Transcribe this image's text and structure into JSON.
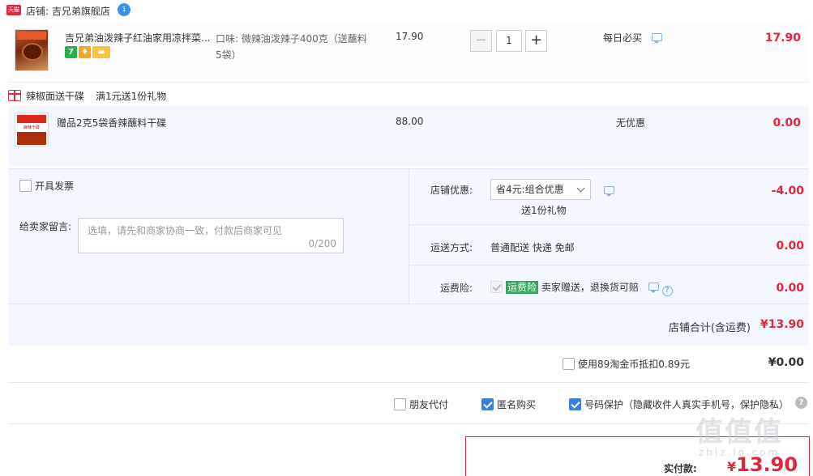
{
  "shop": {
    "badge": "天猫",
    "name": "店铺: 吉兄弟旗舰店",
    "ww_badge": "1"
  },
  "item1": {
    "title": "吉兄弟油泼辣子红油家用凉拌菜...",
    "tag_seven": "7",
    "spec": "口味: 微辣油泼辣子400克（送蘸料5袋）",
    "unit_price": "17.90",
    "quantity": "1",
    "minus": "−",
    "plus": "+",
    "promo": "每日必买",
    "total": "17.90"
  },
  "gift": {
    "header_a": "辣椒面送干碟",
    "header_b": "满1元送1份礼物",
    "thumb_text": "麻辣干碟",
    "title": "赠品2克5袋香辣蘸料干碟",
    "unit_price": "88.00",
    "promo": "无优惠",
    "total": "0.00"
  },
  "options": {
    "invoice_label": "开具发票",
    "message_label": "给卖家留言:",
    "message_placeholder": "选填，请先和商家协商一致，付款后商家可见",
    "message_count": "0/200",
    "shop_discount_label": "店铺优惠:",
    "shop_discount_selected": "省4元:组合优惠",
    "shop_discount_note": "送1份礼物",
    "shop_discount_value": "-4.00",
    "shipping_label": "运送方式:",
    "shipping_value": "普通配送 快递 免邮",
    "shipping_cost": "0.00",
    "insurance_label": "运费险:",
    "insurance_tag": "运费险",
    "insurance_text": "卖家赠送，退换货可赔",
    "insurance_cost": "0.00",
    "help": "?",
    "shop_total_label": "店铺合计(含运费)",
    "shop_total_value": "¥13.90"
  },
  "coins": {
    "label": "使用89淘金币抵扣0.89元",
    "value": "¥0.00"
  },
  "extras": {
    "friend_pay": "朋友代付",
    "anonymous": "匿名购买",
    "number_protect": "号码保护（隐藏收件人真实手机号，保护隐私）",
    "help": "?"
  },
  "pay": {
    "label": "实付款:",
    "currency": "¥",
    "amount": "13.90"
  },
  "watermark": {
    "text": "值值值",
    "sub": "zhiz.lo.com"
  },
  "colors": {
    "price_red": "#e4263c",
    "check_blue": "#3a7ee4",
    "insurance_green": "#3aa45c",
    "panel_bg": "#f4f7fd"
  }
}
